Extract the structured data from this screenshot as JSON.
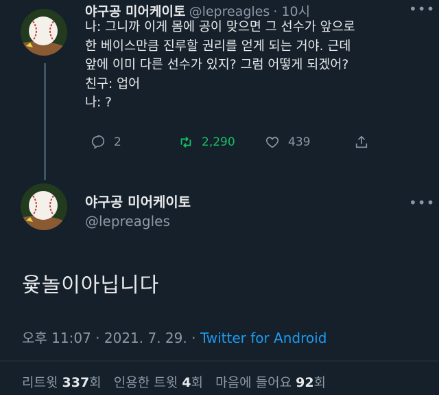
{
  "tweet1": {
    "name": "야구공 미어케이토",
    "handle": "@lepreagles",
    "time": "· 10시",
    "lines": [
      "나: 그니까 이게 몸에 공이 맞으면 그 선수가 앞으로",
      "한 베이스만큼 진루할 권리를 얻게 되는 거야. 근데",
      "앞에 이미 다른 선수가 있지? 그럼 어떻게 되겠어?",
      "친구: 업어",
      "나: ?"
    ],
    "replies": "2",
    "retweets": "2,290",
    "likes": "439"
  },
  "tweet2": {
    "name": "야구공 미어케이토",
    "handle": "@lepreagles",
    "text": "윷놀이아닙니다",
    "timestamp": "오후 11:07 · 2021. 7. 29. · ",
    "source": "Twitter for Android",
    "stats": {
      "retweet_label": "리트윗",
      "retweet_count": "337",
      "retweet_unit": "회",
      "quote_label": "인용한 트윗",
      "quote_count": "4",
      "quote_unit": "회",
      "like_label": "마음에 들어요",
      "like_count": "92",
      "like_unit": "회"
    }
  },
  "icons": {
    "avatar": "baseball-icon",
    "more": "more-icon",
    "reply": "reply-icon",
    "retweet": "retweet-icon",
    "like": "heart-icon",
    "share": "share-icon"
  },
  "colors": {
    "background": "#15202b",
    "retweet_green": "#17bf63",
    "link_blue": "#1d9bf0",
    "muted": "#8b98a5"
  }
}
